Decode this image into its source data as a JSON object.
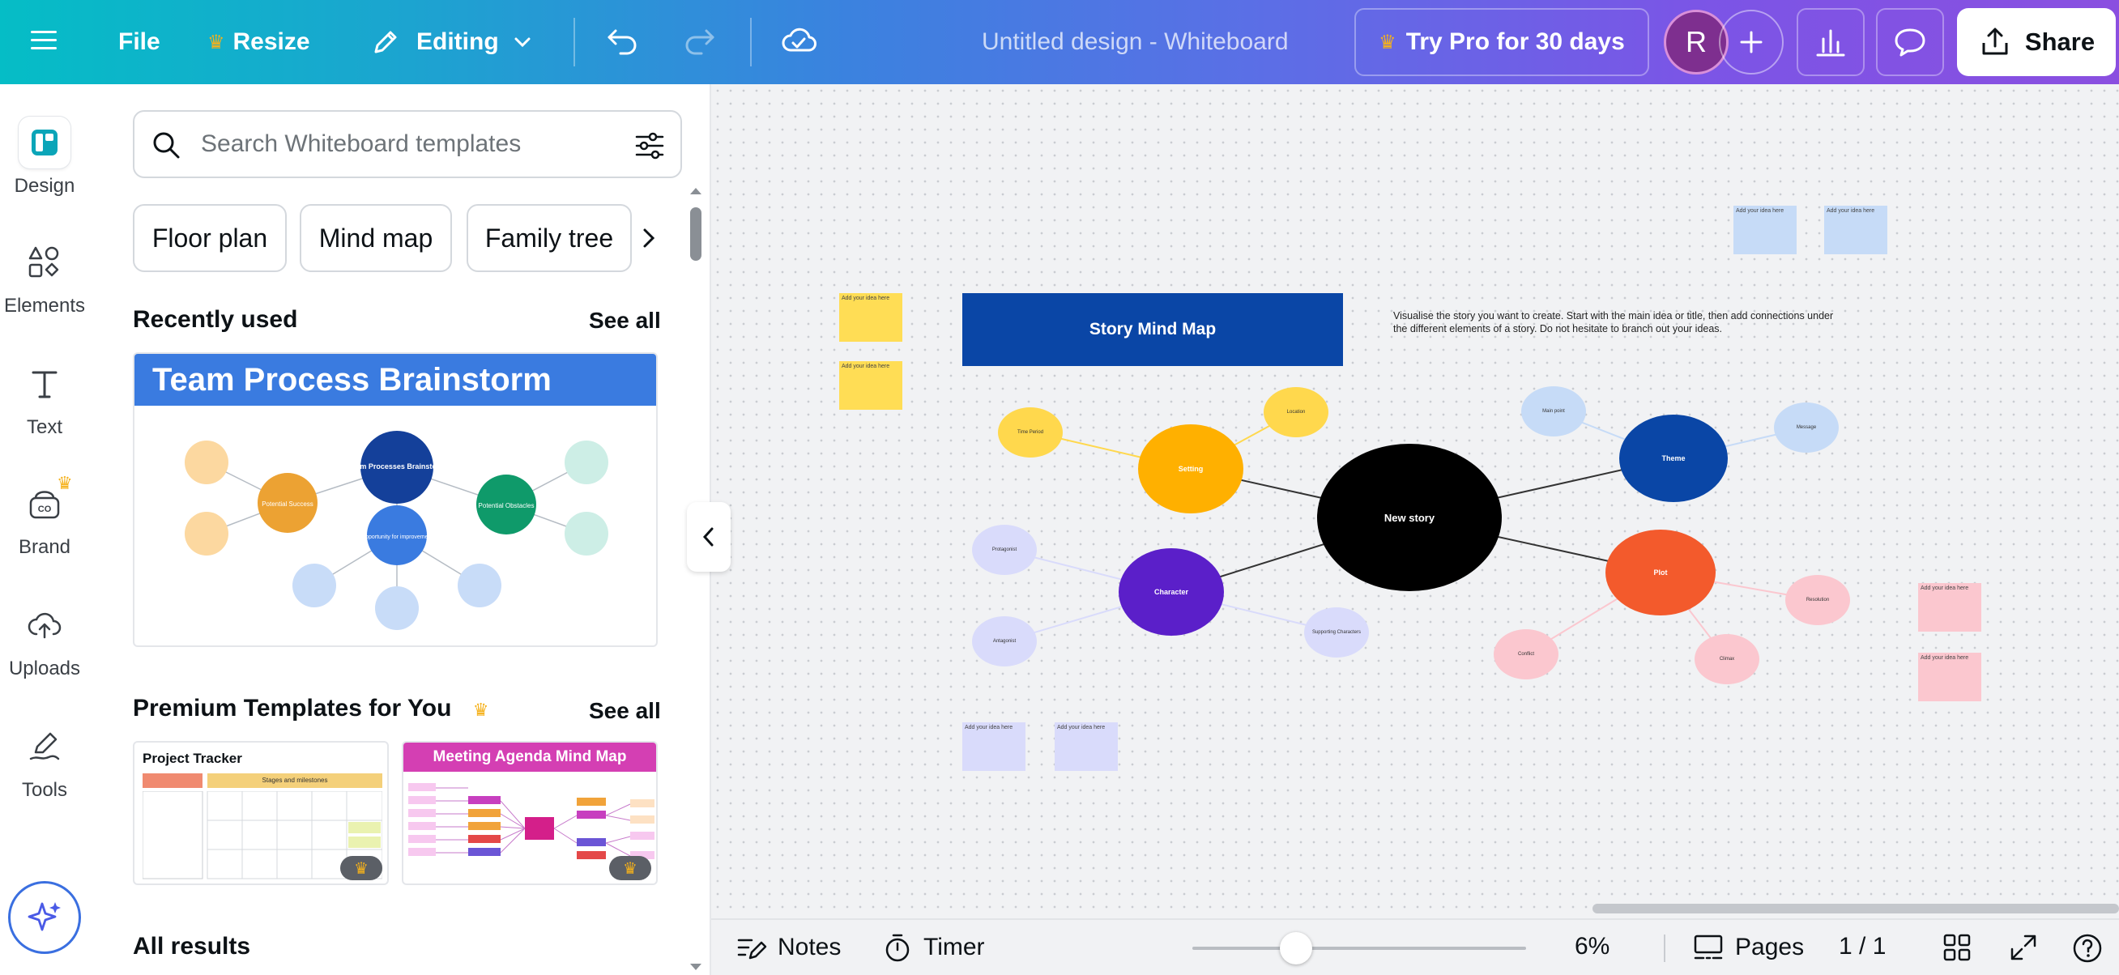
{
  "topbar": {
    "file_label": "File",
    "resize_label": "Resize",
    "editing_label": "Editing",
    "doc_title": "Untitled design - Whiteboard",
    "try_pro_label": "Try Pro for 30 days",
    "avatar_letter": "R",
    "share_label": "Share"
  },
  "rail": {
    "items": [
      {
        "label": "Design",
        "icon": "design-icon"
      },
      {
        "label": "Elements",
        "icon": "elements-icon"
      },
      {
        "label": "Text",
        "icon": "text-icon"
      },
      {
        "label": "Brand",
        "icon": "brand-icon"
      },
      {
        "label": "Uploads",
        "icon": "uploads-icon"
      },
      {
        "label": "Tools",
        "icon": "tools-icon"
      }
    ]
  },
  "panel": {
    "search_placeholder": "Search Whiteboard templates",
    "chips": [
      "Floor plan",
      "Mind map",
      "Family tree"
    ],
    "recently_used_title": "Recently used",
    "see_all": "See all",
    "recent_template": {
      "title": "Team Process Brainstorm",
      "center": "Team Processes Brainstorm",
      "nodes": [
        "Potential Success",
        "Opportunity for improvement",
        "Potential Obstacles"
      ]
    },
    "premium_title": "Premium Templates for You",
    "premium_templates": [
      {
        "title": "Project Tracker",
        "subtitle": "Stages and milestones"
      },
      {
        "title": "Meeting Agenda Mind Map"
      }
    ],
    "all_results_title": "All results"
  },
  "canvas": {
    "map_title": "Story Mind Map",
    "instructions": "Visualise the story you want to create. Start with the main idea or title, then add connections under the different elements of a story. Do not hesitate to branch out your ideas.",
    "sticky_text": "Add your idea here",
    "center_node": "New story",
    "nodes": {
      "setting": "Setting",
      "character": "Character",
      "theme": "Theme",
      "plot": "Plot",
      "time_period": "Time Period",
      "location": "Location",
      "protagonist": "Protagonist",
      "antagonist": "Antagonist",
      "supporting": "Supporting Characters",
      "main_point": "Main point",
      "message": "Message",
      "conflict": "Conflict",
      "climax": "Climax",
      "resolution": "Resolution"
    },
    "colors": {
      "title_bg": "#0a46a6",
      "setting": "#ffb000",
      "setting_sub": "#ffd84d",
      "character": "#5b1fc9",
      "character_sub": "#d9dbfb",
      "theme": "#0a46a6",
      "theme_sub": "#c6dbf7",
      "plot": "#f35a2c",
      "plot_sub": "#fbc7cf",
      "center": "#000000"
    }
  },
  "bottombar": {
    "notes_label": "Notes",
    "timer_label": "Timer",
    "zoom_label": "6%",
    "pages_label": "Pages",
    "page_counter": "1 / 1",
    "zoom_fraction": 0.31
  }
}
